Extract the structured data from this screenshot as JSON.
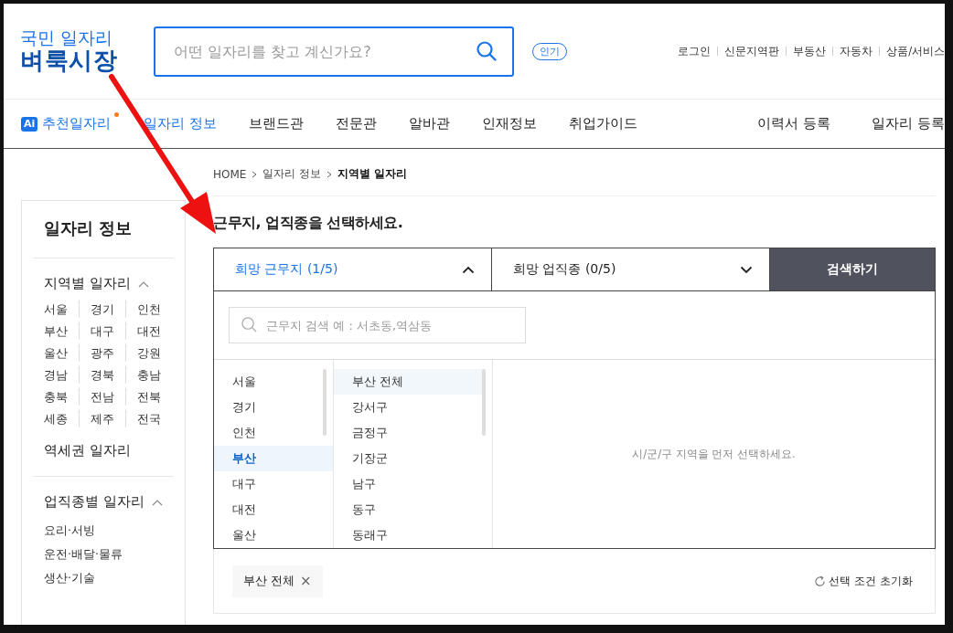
{
  "logo": {
    "line1": "국민 일자리",
    "line2": "벼룩시장"
  },
  "search": {
    "placeholder": "어떤 일자리를 찾고 계신가요?"
  },
  "popular_badge": "인기",
  "top_links": [
    "로그인",
    "신문지역판",
    "부동산",
    "자동차",
    "상품/서비스"
  ],
  "nav": {
    "ai_item": {
      "badge": "Ai",
      "label": "추천일자리",
      "new_dot": true
    },
    "items": [
      {
        "label": "일자리 정보",
        "selected": true
      },
      {
        "label": "브랜드관",
        "selected": false
      },
      {
        "label": "전문관",
        "selected": false
      },
      {
        "label": "알바관",
        "selected": false
      },
      {
        "label": "인재정보",
        "selected": false
      },
      {
        "label": "취업가이드",
        "selected": false
      }
    ],
    "right_items": [
      "이력서 등록",
      "일자리 등록"
    ]
  },
  "breadcrumb": [
    {
      "label": "HOME",
      "current": false
    },
    {
      "label": "일자리 정보",
      "current": false
    },
    {
      "label": "지역별 일자리",
      "current": true
    }
  ],
  "sidebar": {
    "title": "일자리 정보",
    "sections": [
      {
        "kind": "grid",
        "title": "지역별 일자리",
        "expanded": true,
        "items": [
          "서울",
          "경기",
          "인천",
          "부산",
          "대구",
          "대전",
          "울산",
          "광주",
          "강원",
          "경남",
          "경북",
          "충남",
          "충북",
          "전남",
          "전북",
          "세종",
          "제주",
          "전국"
        ]
      },
      {
        "kind": "plain",
        "title": "역세권 일자리"
      },
      {
        "kind": "list",
        "title": "업직종별 일자리",
        "expanded": true,
        "items": [
          "요리·서빙",
          "운전·배달·물류",
          "생산·기술"
        ]
      }
    ]
  },
  "heading": "근무지, 업직종을 선택하세요.",
  "selector": {
    "tabs": [
      {
        "label": "희망 근무지 (1/5)",
        "selected": true,
        "expanded": true
      },
      {
        "label": "희망 업직종 (0/5)",
        "selected": false,
        "expanded": false
      }
    ],
    "search_button": "검색하기",
    "location_search": {
      "placeholder": "근무지 검색 예 : 서초동,역삼동"
    },
    "regions": [
      {
        "label": "서울",
        "selected": false
      },
      {
        "label": "경기",
        "selected": false
      },
      {
        "label": "인천",
        "selected": false
      },
      {
        "label": "부산",
        "selected": true
      },
      {
        "label": "대구",
        "selected": false
      },
      {
        "label": "대전",
        "selected": false
      },
      {
        "label": "울산",
        "selected": false
      }
    ],
    "districts": [
      {
        "label": "부산 전체",
        "selected": true
      },
      {
        "label": "강서구",
        "selected": false
      },
      {
        "label": "금정구",
        "selected": false
      },
      {
        "label": "기장군",
        "selected": false
      },
      {
        "label": "남구",
        "selected": false
      },
      {
        "label": "동구",
        "selected": false
      },
      {
        "label": "동래구",
        "selected": false
      }
    ],
    "hint": "시/군/구 지역을 먼저 선택하세요.",
    "selected_tags": [
      {
        "label": "부산 전체",
        "remove": "×"
      }
    ],
    "reset_label": "선택 조건 초기화"
  }
}
